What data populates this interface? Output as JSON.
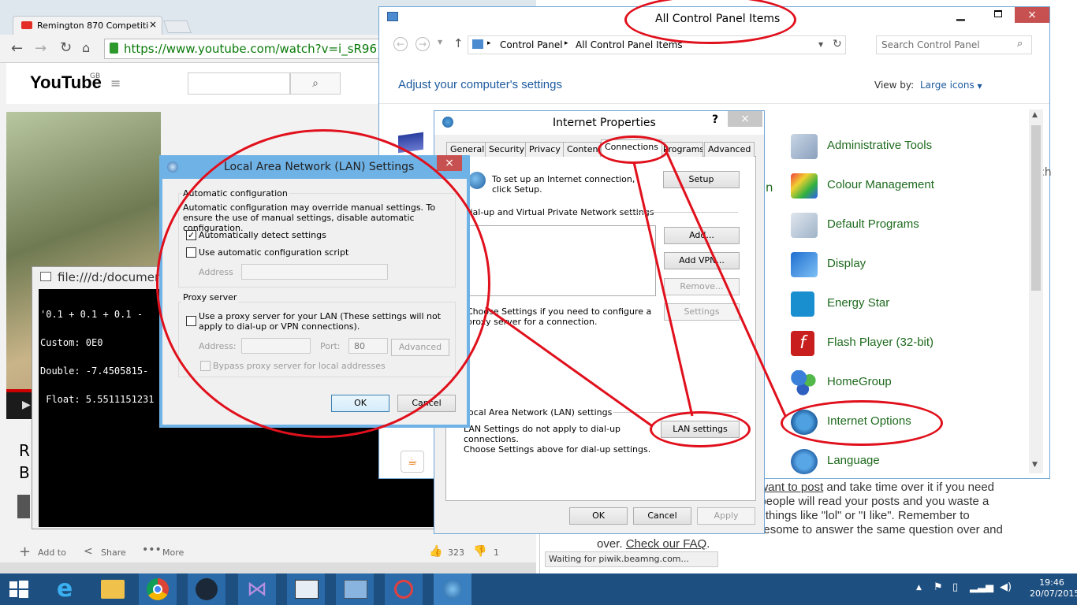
{
  "browser": {
    "tab_title": "Remington 870 Competiti",
    "url": "https://www.youtube.com/watch?v=i_sR96Ojn",
    "yt_logo": "YouTube",
    "yt_region": "GB",
    "video_title_partial": [
      "R",
      "B"
    ],
    "likes": "323",
    "dislikes": "1",
    "actions": {
      "add": "Add to",
      "share": "Share",
      "more": "More"
    }
  },
  "console": {
    "title": "file:///d:/documents",
    "lines": [
      "'0.1 + 0.1 + 0.1 -",
      "Custom: 0E0",
      "Double: -7.4505815-",
      " Float: 5.5511151231"
    ]
  },
  "control_panel": {
    "title": "All Control Panel Items",
    "breadcrumb": [
      "Control Panel",
      "All Control Panel Items"
    ],
    "search_placeholder": "Search Control Panel",
    "heading": "Adjust your computer's settings",
    "view_by_label": "View by:",
    "view_by_value": "Large icons",
    "items": [
      {
        "label": "Administrative Tools",
        "icon": "admin-tools-icon"
      },
      {
        "label": "Colour Management",
        "icon": "colour-management-icon"
      },
      {
        "label": "Default Programs",
        "icon": "default-programs-icon"
      },
      {
        "label": "Display",
        "icon": "display-icon"
      },
      {
        "label": "Energy Star",
        "icon": "energy-star-icon"
      },
      {
        "label": "Flash Player (32-bit)",
        "icon": "flash-icon"
      },
      {
        "label": "HomeGroup",
        "icon": "homegroup-icon"
      },
      {
        "label": "Internet Options",
        "icon": "internet-options-icon"
      },
      {
        "label": "Language",
        "icon": "language-icon"
      }
    ],
    "left_partial": "n",
    "right_partial": "ch"
  },
  "forum": {
    "line1_link": "you want to post",
    "line1_rest": " and take time over it if you need",
    "line2": "s of people will read your posts and you waste a",
    "line3": "write things like \"lol\" or \"I like\". Remember to",
    "line4": "be tiresome to answer the same question over and",
    "line5_pre": "over. ",
    "line5_link": "Check our FAQ",
    "line5_post": ".",
    "status": "Waiting for piwik.beamng.com..."
  },
  "internet_properties": {
    "title": "Internet Properties",
    "help": "?",
    "tabs": [
      "General",
      "Security",
      "Privacy",
      "Content",
      "Connections",
      "Programs",
      "Advanced"
    ],
    "active_tab": "Connections",
    "setup_text": "To set up an Internet connection, click Setup.",
    "setup_btn": "Setup",
    "dialup_group": "Dial-up and Virtual Private Network settings",
    "add_btn": "Add...",
    "add_vpn_btn": "Add VPN...",
    "remove_btn": "Remove...",
    "settings_btn": "Settings",
    "proxy_text": "Choose Settings if you need to configure a proxy server for a connection.",
    "lan_group": "Local Area Network (LAN) settings",
    "lan_text1": "LAN Settings do not apply to dial-up connections.",
    "lan_text2": "Choose Settings above for dial-up settings.",
    "lan_btn": "LAN settings",
    "ok": "OK",
    "cancel": "Cancel",
    "apply": "Apply"
  },
  "lan_dialog": {
    "title": "Local Area Network (LAN) Settings",
    "auto_group": "Automatic configuration",
    "auto_desc": "Automatic configuration may override manual settings.  To ensure the use of manual settings, disable automatic configuration.",
    "auto_detect": "Automatically detect settings",
    "auto_script": "Use automatic configuration script",
    "address_label": "Address",
    "proxy_group": "Proxy server",
    "proxy_desc": "Use a proxy server for your LAN (These settings will not apply to dial-up or VPN connections).",
    "address2_label": "Address:",
    "port_label": "Port:",
    "port_value": "80",
    "advanced": "Advanced",
    "bypass": "Bypass proxy server for local addresses",
    "ok": "OK",
    "cancel": "Cancel"
  },
  "taskbar": {
    "time": "19:46",
    "date": "20/07/2015",
    "icons": [
      "start-icon",
      "ie-icon",
      "explorer-icon",
      "chrome-icon",
      "steam-icon",
      "visual-studio-icon",
      "app-icon",
      "control-panel-icon",
      "snipping-tool-icon",
      "internet-options-icon"
    ]
  },
  "colors": {
    "accent": "#1c5a9e",
    "annotation": "#e0101c",
    "cp_green": "#1e6a1e",
    "taskbar": "#1d4f80"
  }
}
